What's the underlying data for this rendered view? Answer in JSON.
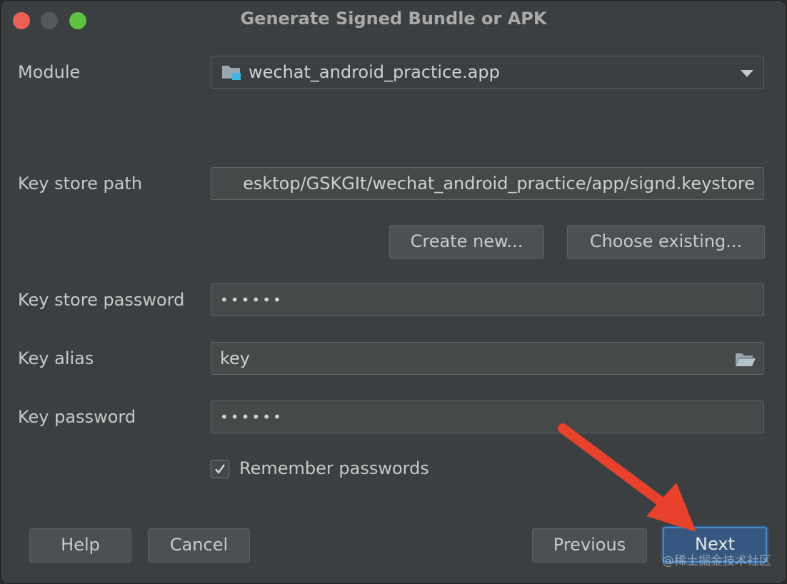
{
  "window": {
    "title": "Generate Signed Bundle or APK"
  },
  "form": {
    "module_label": "Module",
    "module_value": "wechat_android_practice.app",
    "keystore_path_label": "Key store path",
    "keystore_path_value": "esktop/GSKGIt/wechat_android_practice/app/signd.keystore",
    "create_new_label": "Create new...",
    "choose_existing_label": "Choose existing...",
    "keystore_password_label": "Key store password",
    "keystore_password_value": "••••••",
    "key_alias_label": "Key alias",
    "key_alias_value": "key",
    "key_password_label": "Key password",
    "key_password_value": "••••••",
    "remember_label": "Remember passwords",
    "remember_checked": true
  },
  "footer": {
    "help_label": "Help",
    "cancel_label": "Cancel",
    "previous_label": "Previous",
    "next_label": "Next"
  },
  "overlay": {
    "watermark": "@稀土掘金技术社区",
    "annotation_arrow_color": "#e8412c"
  },
  "colors": {
    "window_bg": "#3c3f41",
    "primary_button": "#365880",
    "primary_border": "#4e8ac2"
  }
}
